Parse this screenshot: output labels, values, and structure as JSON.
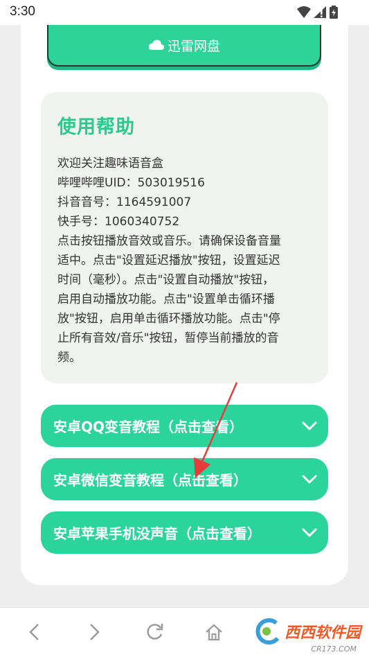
{
  "status_bar": {
    "time": "3:30",
    "icons": [
      "wifi-icon",
      "signal-icon",
      "battery-icon"
    ]
  },
  "top_button": {
    "label": "迅雷网盘",
    "icon": "cloud-icon",
    "color": "#2ed39a"
  },
  "help": {
    "title": "使用帮助",
    "lines": [
      "欢迎关注趣味语音盒",
      "哔哩哔哩UID：503019516",
      "抖音音号：1164591007",
      "快手号：1060340752"
    ],
    "description_lines": [
      "点击按钮播放音效或音乐。请确保设备音量",
      "适中。点击\"设置延迟播放\"按钮，设置延迟",
      "时间（毫秒）。点击\"设置自动播放\"按钮，",
      "启用自动播放功能。点击\"设置单击循环播",
      "放\"按钮，启用单击循环播放功能。点击\"停",
      "止所有音效/音乐\"按钮，暂停当前播放的音",
      "频。"
    ],
    "title_color": "#2bc98c"
  },
  "accordions": [
    {
      "label": "安卓QQ变音教程（点击查看）",
      "icon": "chevron-down-icon"
    },
    {
      "label": "安卓微信变音教程（点击查看）",
      "icon": "chevron-down-icon"
    },
    {
      "label": "安卓苹果手机没声音（点击查看）",
      "icon": "chevron-down-icon"
    }
  ],
  "accent_color": "#2ad49a",
  "annotation": {
    "icon": "red-arrow-icon",
    "color": "#e83a3a"
  },
  "bottom_nav": {
    "icons": [
      "back-icon",
      "forward-icon",
      "reload-icon",
      "home-icon"
    ],
    "watermark": {
      "text": "西西软件园",
      "sub": "CR173.COM"
    }
  }
}
